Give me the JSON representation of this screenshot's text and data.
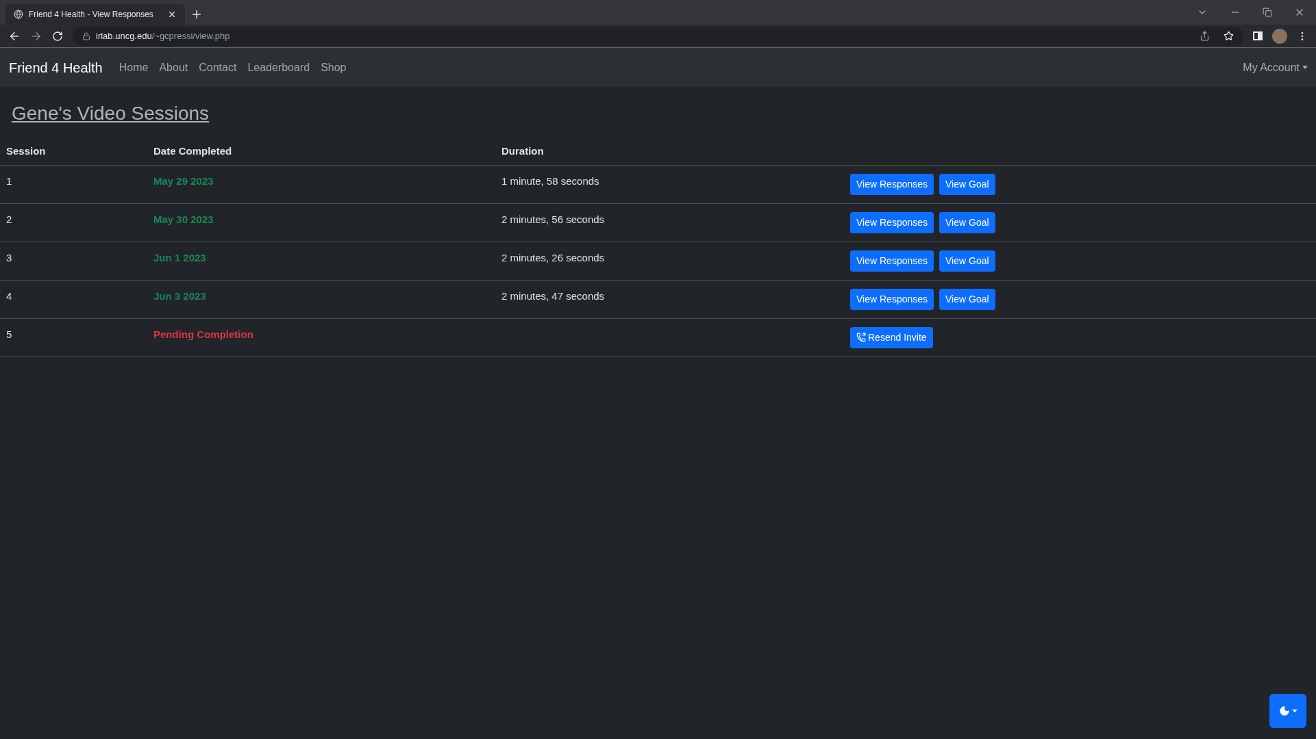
{
  "browser": {
    "tab_title": "Friend 4 Health - View Responses",
    "url_host": "irlab.uncg.edu",
    "url_path": "/~gcpressi/view.php"
  },
  "navbar": {
    "brand": "Friend 4 Health",
    "links": [
      "Home",
      "About",
      "Contact",
      "Leaderboard",
      "Shop"
    ],
    "account": "My Account"
  },
  "page_title": "Gene's Video Sessions",
  "table": {
    "columns": [
      "Session",
      "Date Completed",
      "Duration"
    ],
    "rows": [
      {
        "session": "1",
        "date": "May 29 2023",
        "color": "#198754",
        "duration": "1 minute, 58 seconds",
        "actions": [
          {
            "kind": "view",
            "label": "View Responses"
          },
          {
            "kind": "view",
            "label": "View Goal"
          }
        ]
      },
      {
        "session": "2",
        "date": "May 30 2023",
        "color": "#198754",
        "duration": "2 minutes, 56 seconds",
        "actions": [
          {
            "kind": "view",
            "label": "View Responses"
          },
          {
            "kind": "view",
            "label": "View Goal"
          }
        ]
      },
      {
        "session": "3",
        "date": "Jun 1 2023",
        "color": "#198754",
        "duration": "2 minutes, 26 seconds",
        "actions": [
          {
            "kind": "view",
            "label": "View Responses"
          },
          {
            "kind": "view",
            "label": "View Goal"
          }
        ]
      },
      {
        "session": "4",
        "date": "Jun 3 2023",
        "color": "#198754",
        "duration": "2 minutes, 47 seconds",
        "actions": [
          {
            "kind": "view",
            "label": "View Responses"
          },
          {
            "kind": "view",
            "label": "View Goal"
          }
        ]
      },
      {
        "session": "5",
        "date": "Pending Completion",
        "color": "#dc3545",
        "actions": [
          {
            "kind": "call",
            "label": "Resend Invite"
          }
        ]
      }
    ]
  }
}
